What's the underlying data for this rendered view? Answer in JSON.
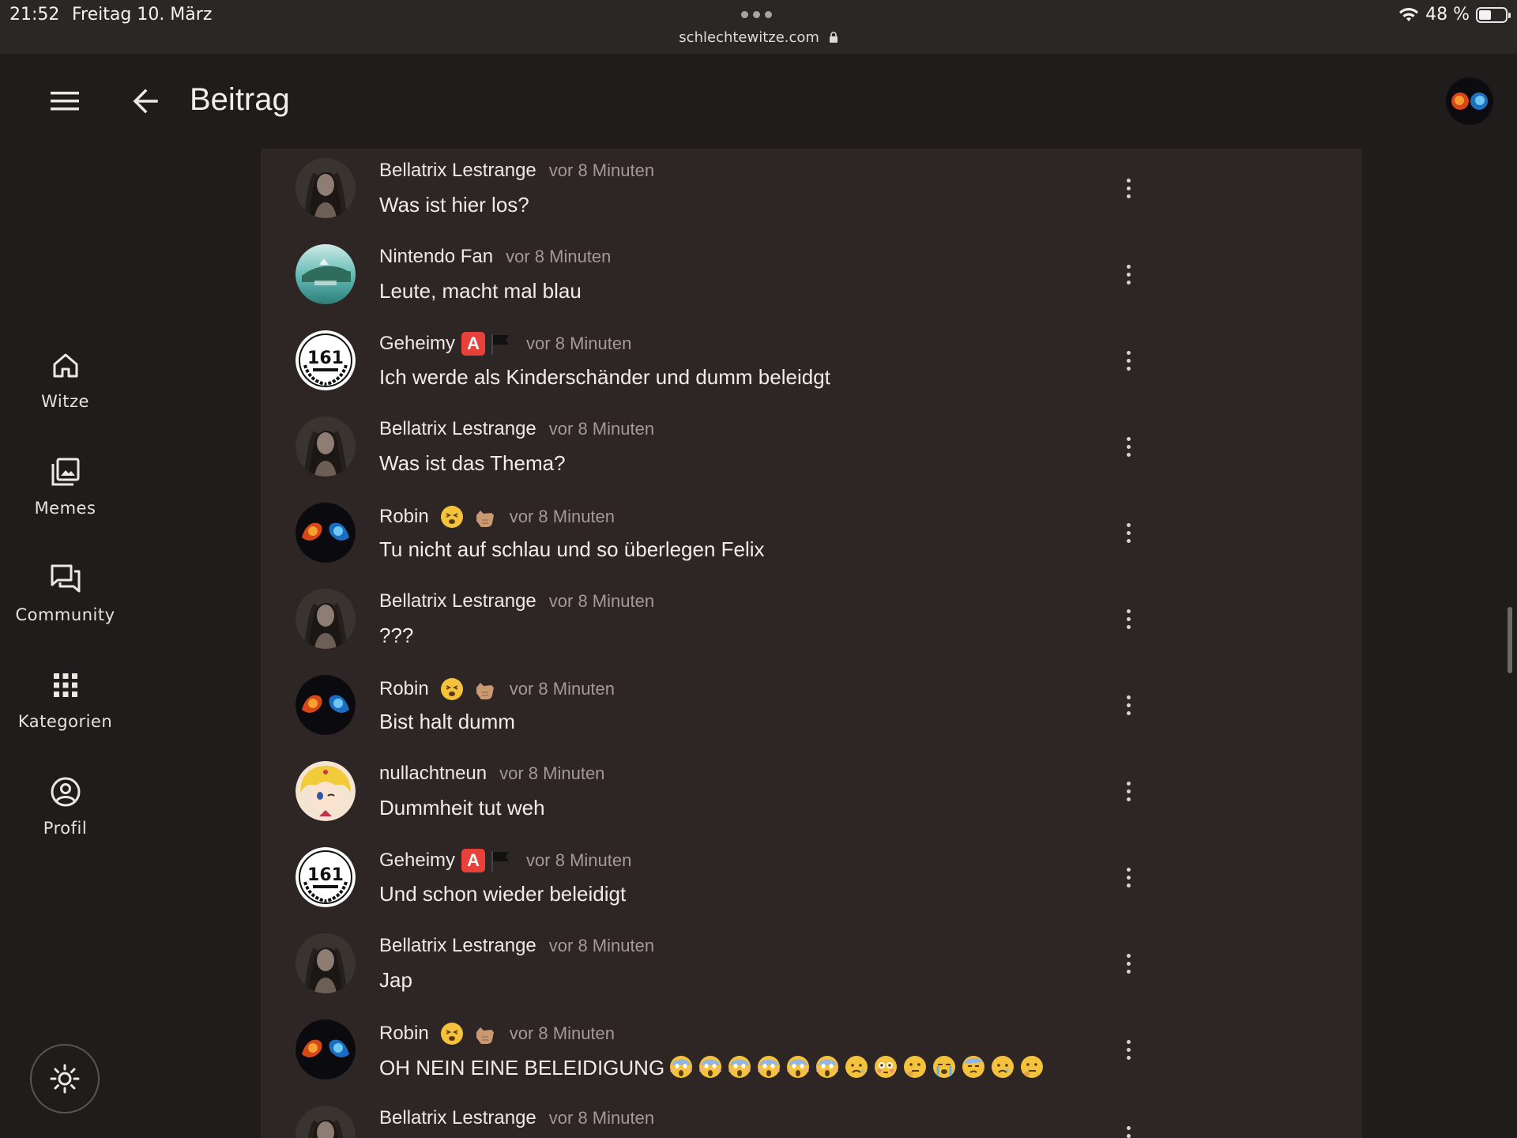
{
  "status": {
    "time": "21:52",
    "date": "Freitag 10. März",
    "url": "schlechtewitze.com",
    "battery": "48 %",
    "battery_level": 0.48
  },
  "header": {
    "title": "Beitrag",
    "menu_icon": "hamburger-menu-icon",
    "back_icon": "arrow-left-icon"
  },
  "nav": {
    "items": [
      {
        "label": "Witze",
        "icon": "home-icon"
      },
      {
        "label": "Memes",
        "icon": "gallery-icon"
      },
      {
        "label": "Community",
        "icon": "forum-icon"
      },
      {
        "label": "Kategorien",
        "icon": "grid-icon"
      },
      {
        "label": "Profil",
        "icon": "account-circle-icon"
      }
    ],
    "theme_icon": "sun-icon"
  },
  "comments": [
    {
      "name": "Bellatrix Lestrange",
      "time": "vor 8 Minuten",
      "text": "Was ist hier los?"
    },
    {
      "name": "Nintendo Fan",
      "time": "vor 8 Minuten",
      "text": "Leute, macht mal blau"
    },
    {
      "name": "Geheimy",
      "time": "vor 8 Minuten",
      "text": "Ich werde als Kinderschänder und dumm beleidgt"
    },
    {
      "name": "Bellatrix Lestrange",
      "time": "vor 8 Minuten",
      "text": "Was ist das Thema?"
    },
    {
      "name": "Robin",
      "time": "vor 8 Minuten",
      "text": "Tu nicht auf schlau und so überlegen Felix"
    },
    {
      "name": "Bellatrix Lestrange",
      "time": "vor 8 Minuten",
      "text": "???"
    },
    {
      "name": "Robin",
      "time": "vor 8 Minuten",
      "text": "Bist halt dumm"
    },
    {
      "name": "nullachtneun",
      "time": "vor 8 Minuten",
      "text": "Dummheit tut weh"
    },
    {
      "name": "Geheimy",
      "time": "vor 8 Minuten",
      "text": "Und schon wieder beleidigt"
    },
    {
      "name": "Bellatrix Lestrange",
      "time": "vor 8 Minuten",
      "text": "Jap"
    },
    {
      "name": "Robin",
      "time": "vor 8 Minuten",
      "text": "OH NEIN EINE BELEIDIGUNG"
    },
    {
      "name": "Bellatrix Lestrange",
      "time": "vor 8 Minuten",
      "text": ""
    }
  ],
  "badge_letter": "A",
  "avatar_text_161": "161",
  "colors": {
    "background": "#201c1b",
    "panel": "#2e2624",
    "badge_red": "#e8413a"
  }
}
